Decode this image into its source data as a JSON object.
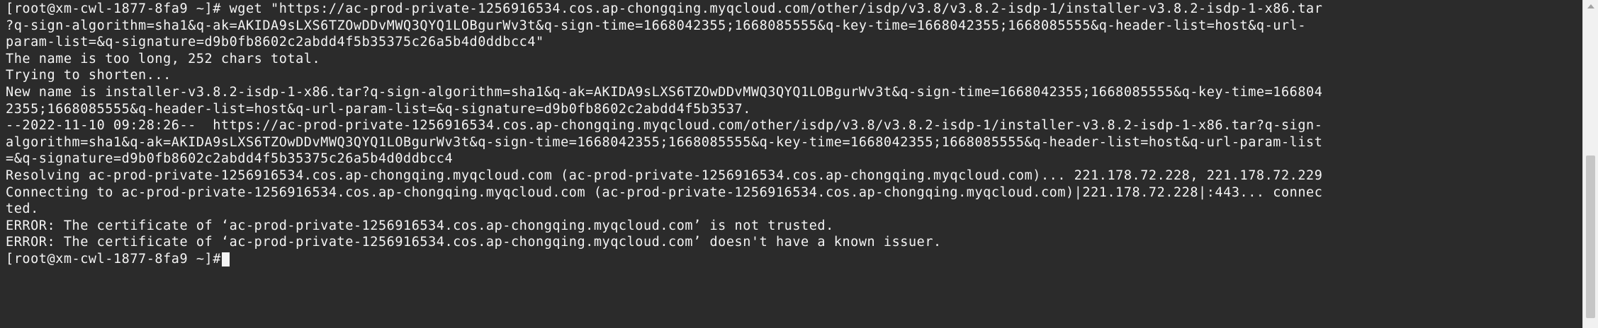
{
  "terminal": {
    "lines": [
      "[root@xm-cwl-1877-8fa9 ~]# wget \"https://ac-prod-private-1256916534.cos.ap-chongqing.myqcloud.com/other/isdp/v3.8/v3.8.2-isdp-1/installer-v3.8.2-isdp-1-x86.tar",
      "?q-sign-algorithm=sha1&q-ak=AKIDA9sLXS6TZOwDDvMWQ3QYQ1LOBgurWv3t&q-sign-time=1668042355;1668085555&q-key-time=1668042355;1668085555&q-header-list=host&q-url-",
      "param-list=&q-signature=d9b0fb8602c2abdd4f5b35375c26a5b4d0ddbcc4\"",
      "The name is too long, 252 chars total.",
      "Trying to shorten...",
      "New name is installer-v3.8.2-isdp-1-x86.tar?q-sign-algorithm=sha1&q-ak=AKIDA9sLXS6TZOwDDvMWQ3QYQ1LOBgurWv3t&q-sign-time=1668042355;1668085555&q-key-time=166804",
      "2355;1668085555&q-header-list=host&q-url-param-list=&q-signature=d9b0fb8602c2abdd4f5b3537.",
      "--2022-11-10 09:28:26--  https://ac-prod-private-1256916534.cos.ap-chongqing.myqcloud.com/other/isdp/v3.8/v3.8.2-isdp-1/installer-v3.8.2-isdp-1-x86.tar?q-sign-",
      "algorithm=sha1&q-ak=AKIDA9sLXS6TZOwDDvMWQ3QYQ1LOBgurWv3t&q-sign-time=1668042355;1668085555&q-key-time=1668042355;1668085555&q-header-list=host&q-url-param-list",
      "=&q-signature=d9b0fb8602c2abdd4f5b35375c26a5b4d0ddbcc4",
      "Resolving ac-prod-private-1256916534.cos.ap-chongqing.myqcloud.com (ac-prod-private-1256916534.cos.ap-chongqing.myqcloud.com)... 221.178.72.228, 221.178.72.229",
      "Connecting to ac-prod-private-1256916534.cos.ap-chongqing.myqcloud.com (ac-prod-private-1256916534.cos.ap-chongqing.myqcloud.com)|221.178.72.228|:443... connec",
      "ted.",
      "ERROR: The certificate of ‘ac-prod-private-1256916534.cos.ap-chongqing.myqcloud.com’ is not trusted.",
      "ERROR: The certificate of ‘ac-prod-private-1256916534.cos.ap-chongqing.myqcloud.com’ doesn't have a known issuer.",
      "[root@xm-cwl-1877-8fa9 ~]#"
    ]
  },
  "colors": {
    "background": "#2b2b2b",
    "foreground": "#f4f4f4",
    "scrollbar_track": "#f1f1f1",
    "scrollbar_thumb": "#c6c6c6"
  }
}
